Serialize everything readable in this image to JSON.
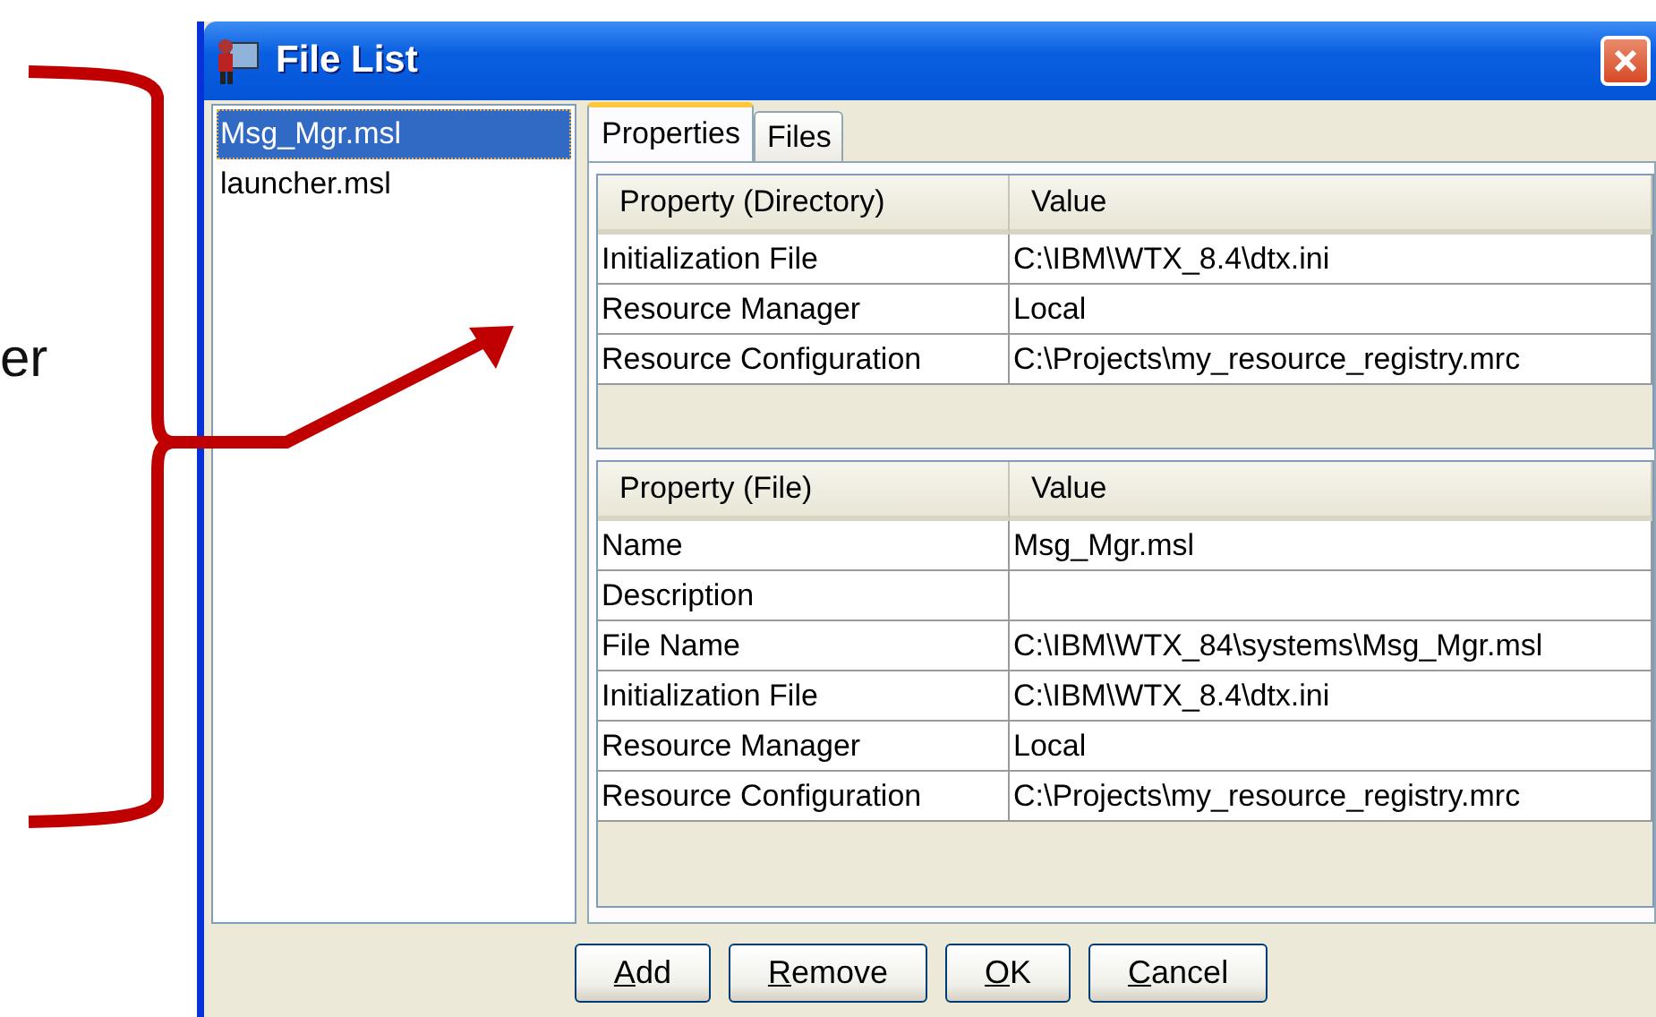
{
  "annotation": {
    "text": "er"
  },
  "window": {
    "title": "File List"
  },
  "file_list": [
    {
      "label": "Msg_Mgr.msl",
      "selected": true
    },
    {
      "label": "launcher.msl",
      "selected": false
    }
  ],
  "tabs": [
    {
      "label": "Properties",
      "selected": true
    },
    {
      "label": "Files",
      "selected": false
    }
  ],
  "directory_table": {
    "columns": [
      "Property (Directory)",
      "Value"
    ],
    "rows": [
      {
        "property": "Initialization File",
        "value": "C:\\IBM\\WTX_8.4\\dtx.ini"
      },
      {
        "property": "Resource Manager",
        "value": "Local"
      },
      {
        "property": "Resource Configuration",
        "value": "C:\\Projects\\my_resource_registry.mrc"
      }
    ]
  },
  "file_table": {
    "columns": [
      "Property (File)",
      "Value"
    ],
    "rows": [
      {
        "property": "Name",
        "value": "Msg_Mgr.msl"
      },
      {
        "property": "Description"
      },
      {
        "property": "File Name",
        "value": "C:\\IBM\\WTX_84\\systems\\Msg_Mgr.msl"
      },
      {
        "property": "Initialization File",
        "value": "C:\\IBM\\WTX_8.4\\dtx.ini"
      },
      {
        "property": "Resource Manager",
        "value": "Local"
      },
      {
        "property": "Resource Configuration",
        "value": "C:\\Projects\\my_resource_registry.mrc"
      }
    ]
  },
  "buttons": [
    {
      "label": "Add",
      "mnemonic_underlined": true
    },
    {
      "label": "Remove",
      "mnemonic_underlined": true
    },
    {
      "label": "OK",
      "mnemonic_underlined": true
    },
    {
      "label": "Cancel",
      "mnemonic_underlined": true
    }
  ]
}
